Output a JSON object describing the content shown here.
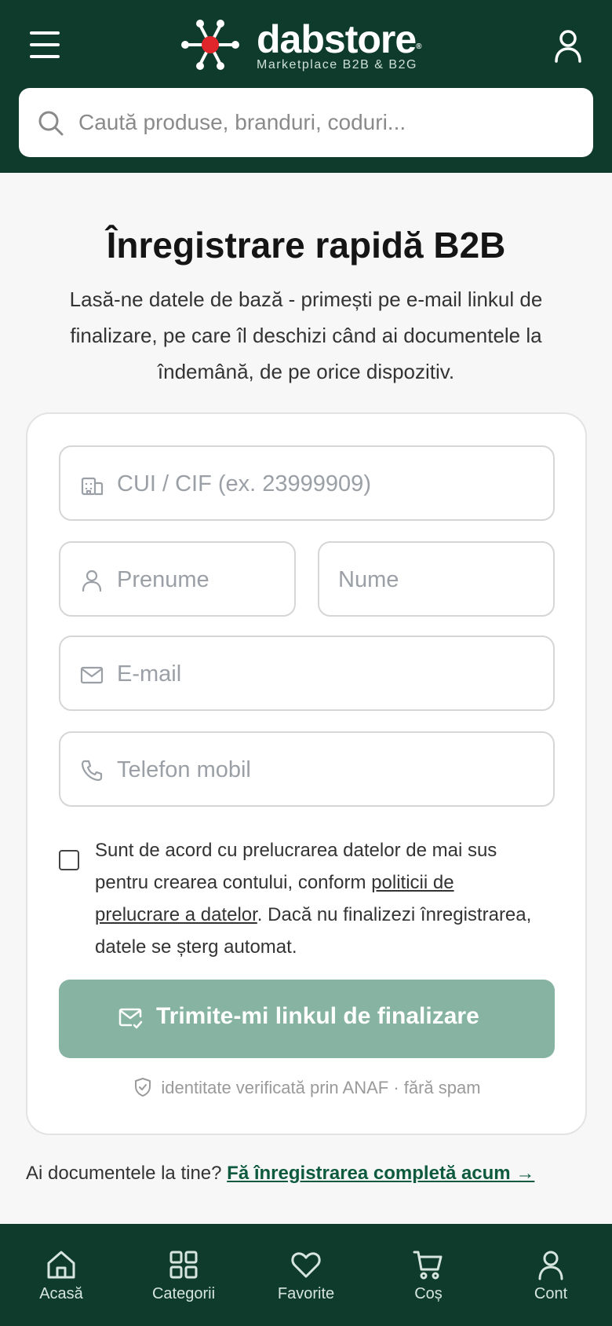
{
  "header": {
    "brand": "dabstore",
    "brand_mark": "®",
    "tagline": "Marketplace B2B & B2G",
    "menu_icon": "hamburger-menu-icon",
    "account_icon": "user-icon",
    "search_placeholder": "Caută produse, branduri, coduri..."
  },
  "main": {
    "title": "Înregistrare rapidă B2B",
    "subtitle": "Lasă-ne datele de bază - primești pe e-mail linkul de finalizare, pe care îl deschizi când ai documentele la îndemână, de pe orice dispozitiv."
  },
  "form": {
    "cui_placeholder": "CUI / CIF (ex. 23999909)",
    "first_name_placeholder": "Prenume",
    "last_name_placeholder": "Nume",
    "email_placeholder": "E-mail",
    "phone_placeholder": "Telefon mobil",
    "consent_before": "Sunt de acord cu prelucrarea datelor de mai sus pentru crearea contului, conform ",
    "consent_link": "politicii de prelucrare a datelor",
    "consent_after": ". Dacă nu finalizezi înregistrarea, datele se șterg automat.",
    "consent_checked": false,
    "submit_label": "Trimite-mi linkul de finalizare",
    "trust_note": "identitate verificată prin ANAF · fără spam"
  },
  "complete_prompt": {
    "text": "Ai documentele la tine? ",
    "link": "Fă înregistrarea completă acum →"
  },
  "bottom_nav": [
    {
      "label": "Acasă",
      "icon": "home-icon"
    },
    {
      "label": "Categorii",
      "icon": "grid-icon"
    },
    {
      "label": "Favorite",
      "icon": "heart-icon"
    },
    {
      "label": "Coș",
      "icon": "cart-icon"
    },
    {
      "label": "Cont",
      "icon": "user-icon"
    }
  ],
  "colors": {
    "brand_dark": "#0e3b2c",
    "accent_red": "#e0262b",
    "button_disabled": "#86b3a2",
    "link_green": "#0e5a3f"
  }
}
